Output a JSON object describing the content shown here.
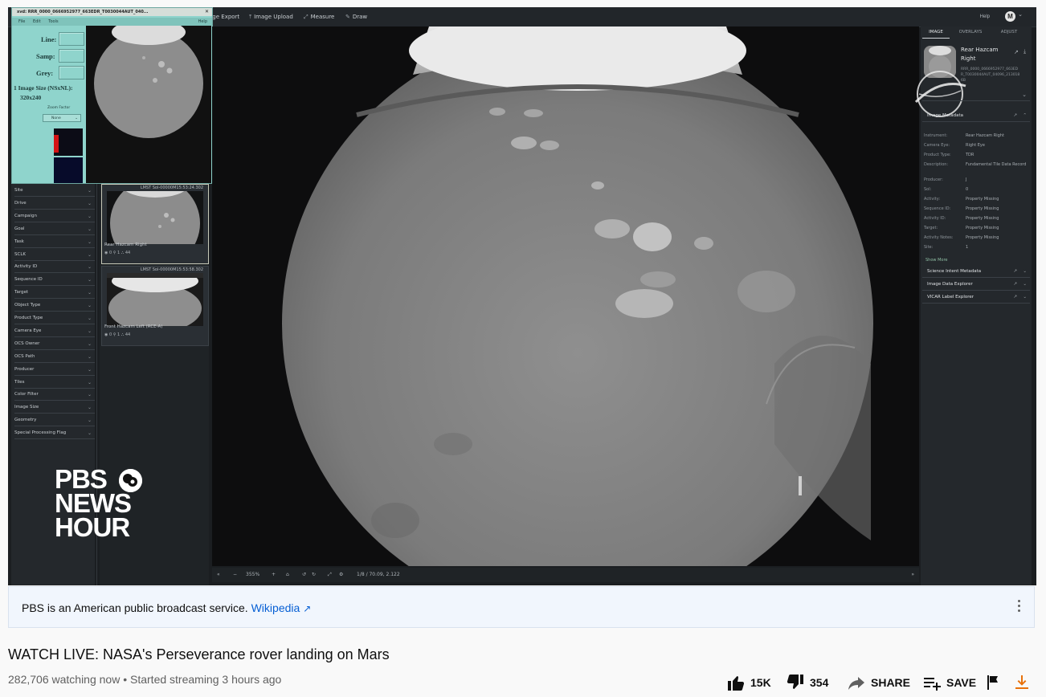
{
  "toolbar": {
    "items": [
      {
        "label": "age Export",
        "icon": "export-icon"
      },
      {
        "label": "Image Upload",
        "icon": "upload-icon"
      },
      {
        "label": "Measure",
        "icon": "measure-icon"
      },
      {
        "label": "Draw",
        "icon": "draw-icon"
      }
    ],
    "help": "Help",
    "avatar": "M"
  },
  "xvd": {
    "title": "xvd: RRR_0000_0666952977_663EDR_T0030044AUT_040...",
    "menu": [
      "File",
      "Edit",
      "Tools"
    ],
    "help": "Help",
    "line_label": "Line:",
    "samp_label": "Samp:",
    "grey_label": "Grey:",
    "size_label": "1 Image Size (NSxNL):",
    "size_value": "320x240",
    "zoom_label": "Zoom Factor",
    "zoom_value": "None"
  },
  "filters": [
    "Site",
    "Drive",
    "Campaign",
    "Goal",
    "Task",
    "SCLK",
    "Activity ID",
    "Sequence ID",
    "Target",
    "Object Type",
    "Product Type",
    "Camera Eye",
    "OCS Owner",
    "OCS Path",
    "Producer",
    "Tiles",
    "Color Filter",
    "Image Size",
    "Geometry",
    "Special Processing Flag"
  ],
  "thumbnails": [
    {
      "time": "LMST Sol-00000M15:53:24.302",
      "label": "Rear Hazcam Right",
      "stats": "◉ 0   ⚲ 1   ⛬ 44"
    },
    {
      "time": "LMST Sol-00000M15:53:58.302",
      "label": "Front Hazcam Left (RCE-A)",
      "stats": "◉ 0   ⚲ 1   ⛬ 44"
    }
  ],
  "logo": {
    "lines": [
      "PBS",
      "NEWS",
      "HOUR"
    ]
  },
  "viewer": {
    "zoom": "355%",
    "coords": "1/8 / 70.09, 2.122"
  },
  "right_panel": {
    "tabs": [
      "IMAGE",
      "OVERLAYS",
      "ADJUST"
    ],
    "title": "Rear Hazcam Right",
    "file": "RRR_0000_0666952977_663EDR_T0030044AUT_04096_2130186B",
    "sections": {
      "metadata": "Image Metadata",
      "science": "Science Intent Metadata",
      "data_explorer": "Image Data Explorer",
      "vicar": "VICAR Label Explorer"
    },
    "metadata": [
      {
        "k": "Instrument:",
        "v": "Rear Hazcam Right"
      },
      {
        "k": "Camera Eye:",
        "v": "Right Eye"
      },
      {
        "k": "Product Type:",
        "v": "TDR"
      },
      {
        "k": "Description:",
        "v": "Fundamental Tile Data Record"
      },
      {
        "k": "Producer:",
        "v": "J"
      },
      {
        "k": "Sol:",
        "v": "0"
      },
      {
        "k": "Activity:",
        "v": "Property Missing"
      },
      {
        "k": "Sequence ID:",
        "v": "Property Missing"
      },
      {
        "k": "Activity ID:",
        "v": "Property Missing"
      },
      {
        "k": "Target:",
        "v": "Property Missing"
      },
      {
        "k": "Activity Notes:",
        "v": "Property Missing"
      },
      {
        "k": "Site:",
        "v": "1"
      }
    ],
    "show_more": "Show More"
  },
  "info_card": {
    "text": "PBS is an American public broadcast service.",
    "link": "Wikipedia"
  },
  "video": {
    "title": "WATCH LIVE: NASA's Perseverance rover landing on Mars",
    "meta": "282,706 watching now • Started streaming 3 hours ago"
  },
  "actions": {
    "likes": "15K",
    "dislikes": "354",
    "share": "SHARE",
    "save": "SAVE"
  },
  "colors": {
    "accent_link": "#065fd4",
    "download": "#e8710a"
  }
}
